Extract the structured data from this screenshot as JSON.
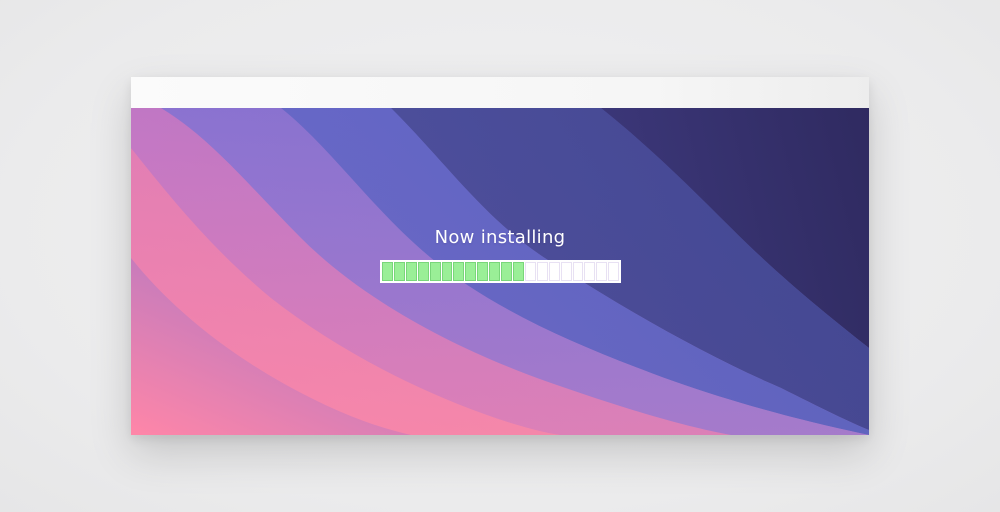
{
  "installer": {
    "status_text": "Now installing",
    "progress": {
      "total_segments": 20,
      "filled_segments": 12,
      "fraction": 0.6
    }
  },
  "colors": {
    "progress_fill": "#9aef97",
    "progress_empty": "#ffffff",
    "wallpaper_pink": "#ff86a8",
    "wallpaper_violet": "#7a6fd3",
    "wallpaper_navy": "#37306a"
  }
}
